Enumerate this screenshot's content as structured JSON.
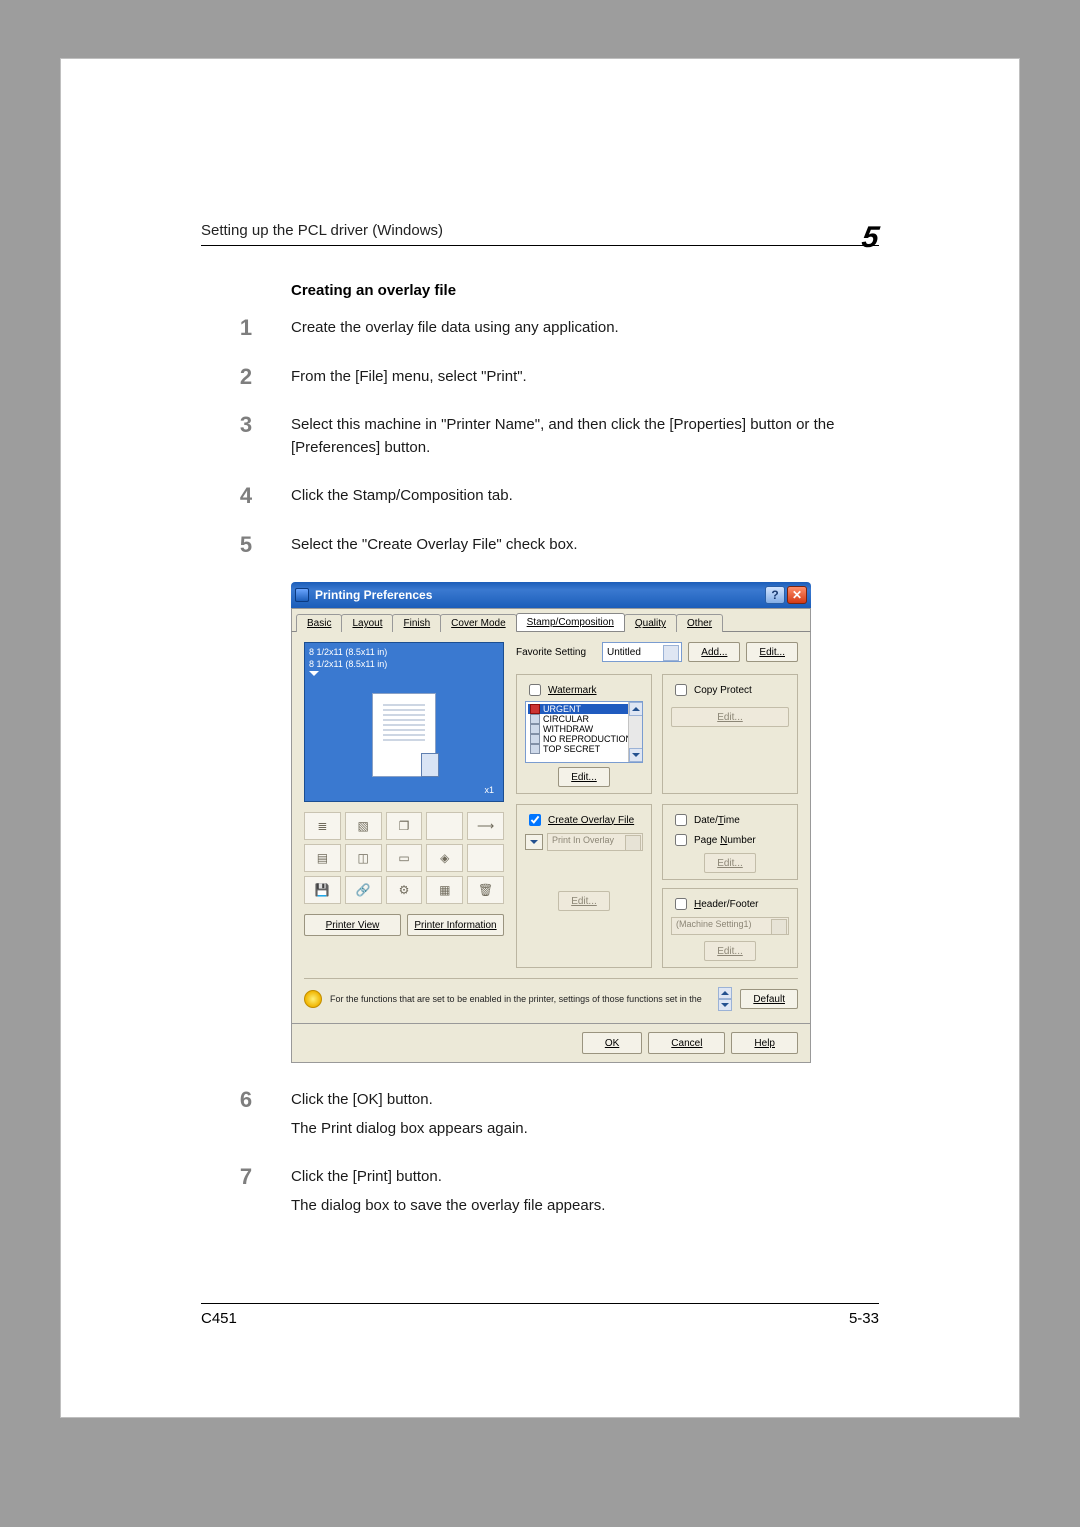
{
  "header": {
    "title": "Setting up the PCL driver (Windows)",
    "chapter_number": "5"
  },
  "section_heading": "Creating an overlay file",
  "steps": [
    {
      "n": "1",
      "text": "Create the overlay file data using any application."
    },
    {
      "n": "2",
      "text": "From the [File] menu, select \"Print\"."
    },
    {
      "n": "3",
      "text": "Select this machine in \"Printer Name\", and then click the [Properties] button or the [Preferences] button."
    },
    {
      "n": "4",
      "text": "Click the Stamp/Composition tab."
    },
    {
      "n": "5",
      "text": "Select the \"Create Overlay File\" check box."
    },
    {
      "n": "6",
      "text1": "Click the [OK] button.",
      "text2": "The Print dialog box appears again."
    },
    {
      "n": "7",
      "text1": "Click the [Print] button.",
      "text2": "The dialog box to save the overlay file appears."
    }
  ],
  "footer": {
    "product": "C451",
    "page": "5-33"
  },
  "dialog": {
    "title": "Printing Preferences",
    "title_button_help": "?",
    "title_button_close": "✕",
    "tabs": [
      "Basic",
      "Layout",
      "Finish",
      "Cover Mode",
      "Stamp/Composition",
      "Quality",
      "Other"
    ],
    "active_tab": 4,
    "preview": {
      "size_top": "8 1/2x11 (8.5x11 in)",
      "size_bottom": "8 1/2x11 (8.5x11 in)",
      "zoom": "x1"
    },
    "icon_names": [
      "pages-icon",
      "xout-icon",
      "stack-icon",
      "",
      "flow-icon",
      "booklet-icon",
      "grid-icon",
      "doc-icon",
      "tint-icon",
      "",
      "save-icon",
      "link-icon",
      "gear-icon",
      "layers-icon",
      "trash-icon"
    ],
    "printer_view": "Printer View",
    "printer_info": "Printer Information",
    "favorite_label": "Favorite Setting",
    "favorite_value": "Untitled",
    "add_btn": "Add...",
    "edit_btn": "Edit...",
    "watermark": {
      "label": "Watermark",
      "options": [
        "URGENT",
        "CIRCULAR",
        "WITHDRAW",
        "NO REPRODUCTION",
        "TOP SECRET"
      ],
      "edit": "Edit..."
    },
    "copy_protect": {
      "label": "Copy Protect",
      "edit": "Edit..."
    },
    "date_time_label": "Date/Time",
    "page_number_label": "Page Number",
    "dtpn_edit": "Edit...",
    "create_overlay": {
      "label": "Create Overlay File",
      "checked": true
    },
    "print_in_overlay": {
      "label": "Print In Overlay",
      "edit": "Edit..."
    },
    "header_footer": {
      "label": "Header/Footer",
      "select": "(Machine Setting1)",
      "edit": "Edit..."
    },
    "hint_text": "For the functions that are set to be enabled in the printer, settings of those functions set in the",
    "default_btn": "Default",
    "ok": "OK",
    "cancel": "Cancel",
    "help": "Help"
  }
}
